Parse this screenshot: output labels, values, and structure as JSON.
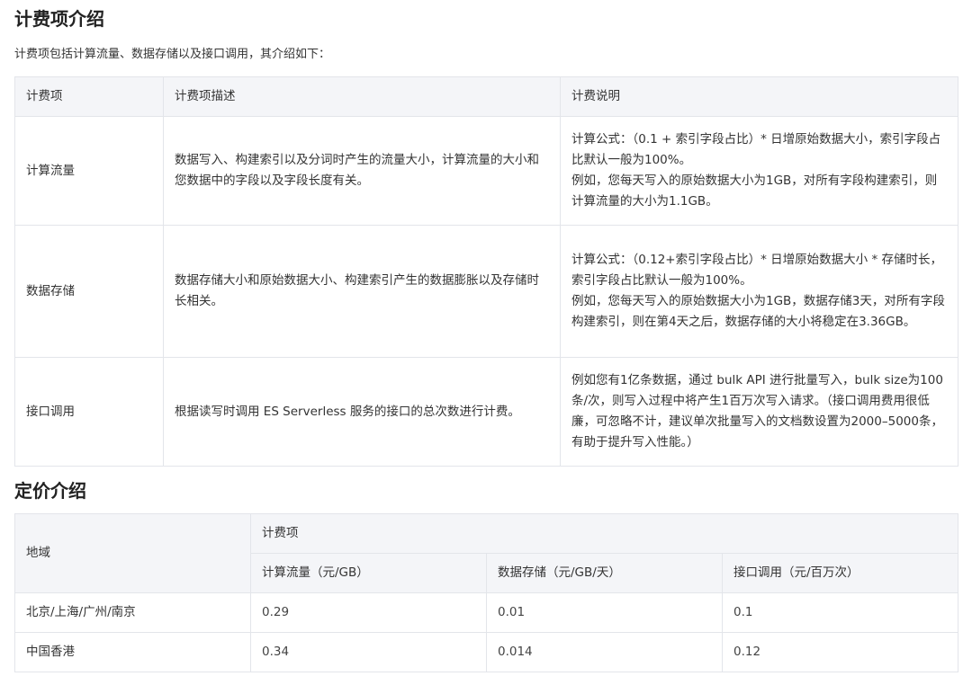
{
  "billing": {
    "title": "计费项介绍",
    "intro": "计费项包括计算流量、数据存储以及接口调用，其介绍如下：",
    "headers": [
      "计费项",
      "计费项描述",
      "计费说明"
    ],
    "rows": [
      {
        "item": "计算流量",
        "desc": "数据写入、构建索引以及分词时产生的流量大小，计算流量的大小和您数据中的字段以及字段长度有关。",
        "note1": "计算公式：（0.1 + 索引字段占比）* 日增原始数据大小，索引字段占比默认一般为100%。",
        "note2": "例如，您每天写入的原始数据大小为1GB，对所有字段构建索引，则计算流量的大小为1.1GB。"
      },
      {
        "item": "数据存储",
        "desc": "数据存储大小和原始数据大小、构建索引产生的数据膨胀以及存储时长相关。",
        "note1": "计算公式：（0.12+索引字段占比）* 日增原始数据大小 * 存储时长，索引字段占比默认一般为100%。",
        "note2": "例如，您每天写入的原始数据大小为1GB，数据存储3天，对所有字段构建索引，则在第4天之后，数据存储的大小将稳定在3.36GB。"
      },
      {
        "item": "接口调用",
        "desc": "根据读写时调用 ES Serverless 服务的接口的总次数进行计费。",
        "note1": "例如您有1亿条数据，通过 bulk API 进行批量写入，bulk size为100条/次，则写入过程中将产生1百万次写入请求。（接口调用费用很低廉，可忽略不计，建议单次批量写入的文档数设置为2000–5000条，有助于提升写入性能。）",
        "note2": ""
      }
    ]
  },
  "pricing": {
    "title": "定价介绍",
    "region_header": "地域",
    "group_header": "计费项",
    "columns": [
      "计算流量（元/GB）",
      "数据存储（元/GB/天）",
      "接口调用（元/百万次）"
    ],
    "rows": [
      {
        "region": "北京/上海/广州/南京",
        "values": [
          "0.29",
          "0.01",
          "0.1"
        ]
      },
      {
        "region": "中国香港",
        "values": [
          "0.34",
          "0.014",
          "0.12"
        ]
      }
    ]
  }
}
